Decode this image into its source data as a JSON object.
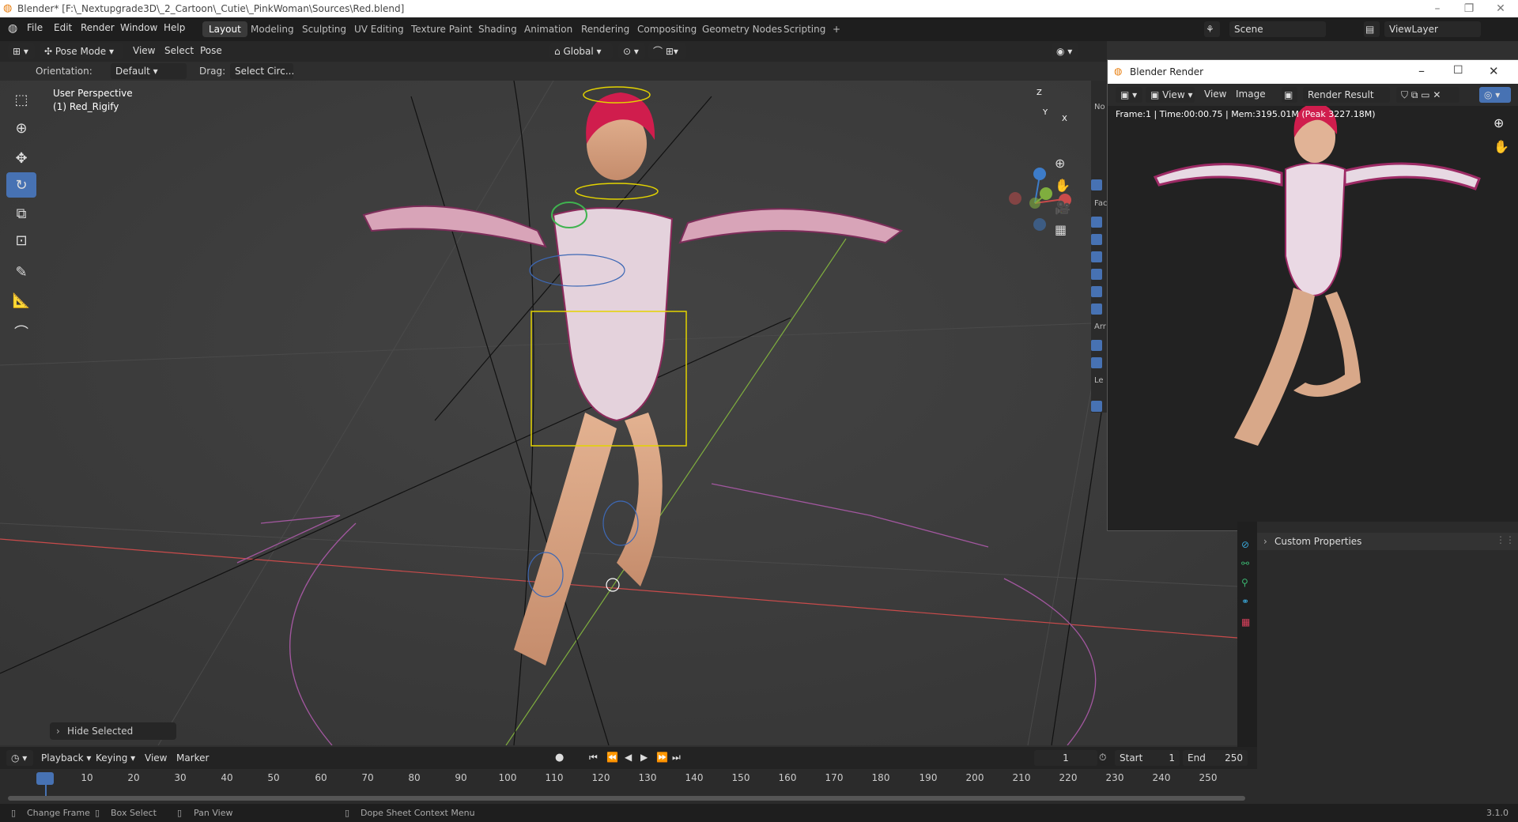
{
  "window": {
    "title": "Blender* [F:\\_Nextupgrade3D\\_2_Cartoon\\_Cutie\\_PinkWoman\\Sources\\Red.blend]"
  },
  "menu": [
    "File",
    "Edit",
    "Render",
    "Window",
    "Help"
  ],
  "workspaces": [
    "Layout",
    "Modeling",
    "Sculpting",
    "UV Editing",
    "Texture Paint",
    "Shading",
    "Animation",
    "Rendering",
    "Compositing",
    "Geometry Nodes",
    "Scripting"
  ],
  "scene": {
    "name": "Scene",
    "view_layer": "ViewLayer"
  },
  "header2": {
    "mode": "Pose Mode",
    "view": "View",
    "select": "Select",
    "pose": "Pose",
    "transform_orientation": "Global"
  },
  "tool_settings": {
    "orientation_label": "Orientation:",
    "orientation_value": "Default",
    "drag_label": "Drag:",
    "drag_value": "Select Circ..."
  },
  "viewport": {
    "perspective": "User Perspective",
    "object": "(1) Red_Rigify",
    "gizmo_axes": {
      "z": "Z",
      "y": "Y",
      "x": "X"
    },
    "colors": {
      "x_axis": "#c94b4b",
      "y_axis": "#7fae3e",
      "z_axis": "#3d7cc9",
      "active_tool": "#4772b3"
    }
  },
  "operator_panel": {
    "label": "Hide Selected"
  },
  "render_window": {
    "title": "Blender Render",
    "view_menu": "View",
    "view2": "View",
    "image_menu": "Image",
    "slot": "Render Result",
    "info": "Frame:1 | Time:00:00.75 | Mem:3195.01M (Peak 3227.18M)"
  },
  "properties": {
    "custom_properties": "Custom Properties",
    "side_labels": [
      "No",
      "Fac",
      "Arr",
      "Le"
    ]
  },
  "timeline": {
    "playback": "Playback",
    "keying": "Keying",
    "view": "View",
    "marker": "Marker",
    "current_frame": "1",
    "start_label": "Start",
    "start": "1",
    "end_label": "End",
    "end": "250",
    "ticks": [
      "1",
      "10",
      "20",
      "30",
      "40",
      "50",
      "60",
      "70",
      "80",
      "90",
      "100",
      "110",
      "120",
      "130",
      "140",
      "150",
      "160",
      "170",
      "180",
      "190",
      "200",
      "210",
      "220",
      "230",
      "240",
      "250"
    ]
  },
  "status_bar": {
    "change_frame": "Change Frame",
    "box_select": "Box Select",
    "pan_view": "Pan View",
    "context_menu": "Dope Sheet Context Menu",
    "version": "3.1.0"
  }
}
